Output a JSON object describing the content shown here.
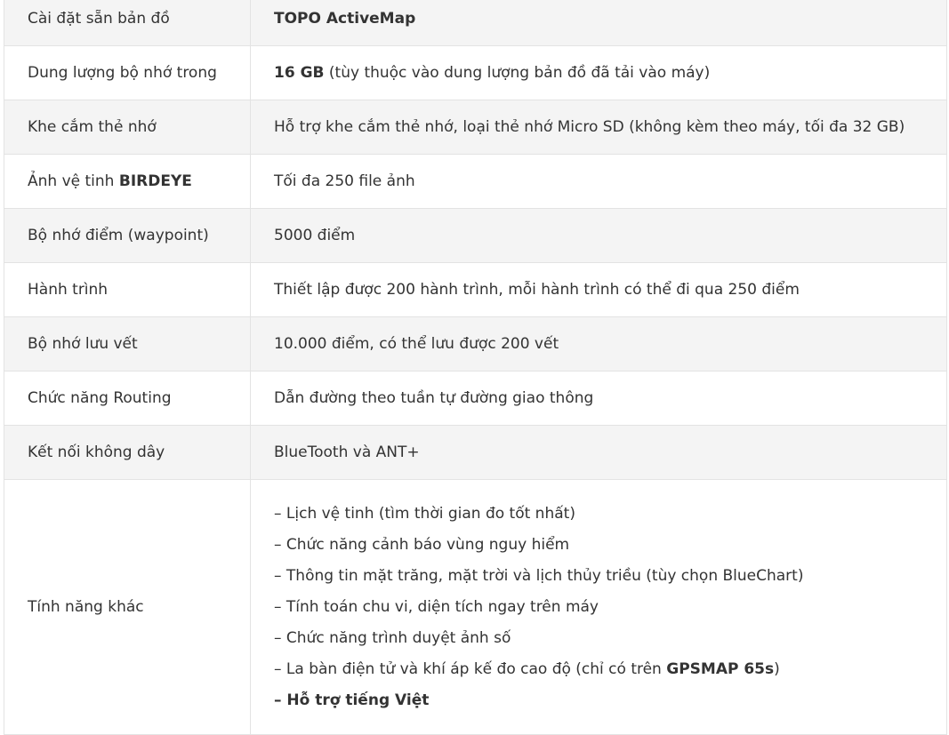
{
  "rows": [
    {
      "label": "Cài đặt sẵn bản đồ",
      "value_bold": "TOPO ActiveMap",
      "value": ""
    },
    {
      "label": "Dung lượng bộ nhớ trong",
      "value_bold": "16 GB",
      "value": " (tùy thuộc vào dung lượng bản đồ đã tải vào máy)"
    },
    {
      "label": "Khe cắm thẻ nhớ",
      "value": "Hỗ trợ khe cắm thẻ nhớ, loại thẻ nhớ Micro SD (không kèm theo máy, tối đa 32 GB)"
    },
    {
      "label": "Ảnh vệ tinh ",
      "label_bold": "BIRDEYE",
      "value": "Tối đa 250 file ảnh"
    },
    {
      "label": "Bộ nhớ điểm (waypoint)",
      "value": "5000 điểm"
    },
    {
      "label": "Hành trình",
      "value": "Thiết lập được 200 hành trình, mỗi hành trình có thể đi qua 250 điểm"
    },
    {
      "label": "Bộ nhớ lưu vết",
      "value": "10.000 điểm, có thể lưu được 200 vết"
    },
    {
      "label": "Chức năng Routing",
      "value": "Dẫn đường theo tuần tự đường giao thông"
    },
    {
      "label": "Kết nối không dây",
      "value": "BlueTooth và ANT+"
    }
  ],
  "other_features": {
    "label": "Tính năng khác",
    "items": [
      "– Lịch vệ tinh (tìm thời gian đo tốt nhất)",
      "– Chức năng cảnh báo vùng nguy hiểm",
      "– Thông tin mặt trăng, mặt trời và lịch thủy triều (tùy chọn BlueChart)",
      "– Tính toán chu vi, diện tích ngay trên máy"
    ],
    "item_photo": "– Chức năng trình duyệt ảnh số",
    "item_compass_prefix": "– La bàn điện tử và khí áp kế đo cao độ (chỉ có trên ",
    "item_compass_bold": "GPSMAP 65s",
    "item_compass_suffix": ")",
    "item_vietnamese": "– Hỗ trợ tiếng Việt"
  }
}
